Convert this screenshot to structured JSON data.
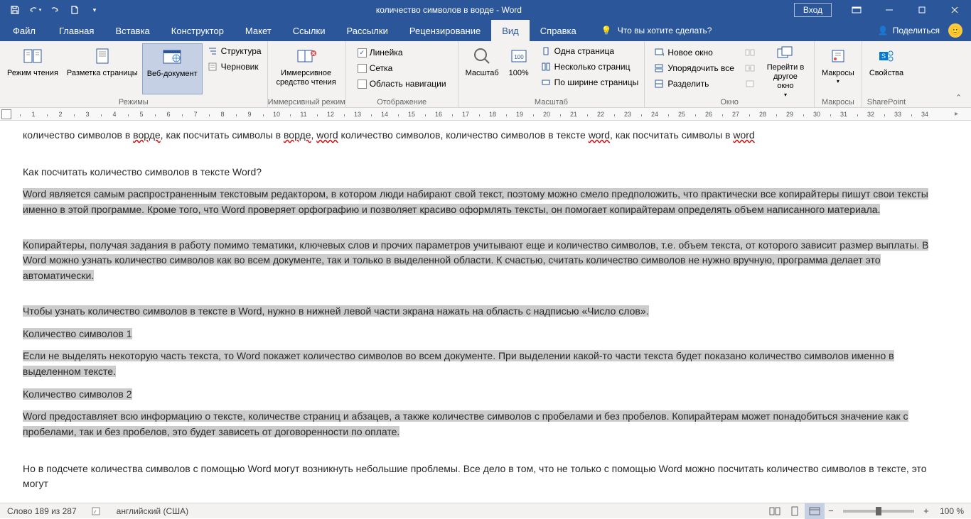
{
  "title": "количество символов в ворде  -  Word",
  "signin": "Вход",
  "tabs": {
    "file": "Файл",
    "items": [
      "Главная",
      "Вставка",
      "Конструктор",
      "Макет",
      "Ссылки",
      "Рассылки",
      "Рецензирование",
      "Вид",
      "Справка"
    ],
    "active": "Вид",
    "tellme_placeholder": "Что вы хотите сделать?",
    "share": "Поделиться"
  },
  "ribbon": {
    "modes": {
      "label": "Режимы",
      "read_mode": "Режим чтения",
      "print_layout": "Разметка страницы",
      "web_layout": "Веб-документ",
      "outline": "Структура",
      "draft": "Черновик"
    },
    "immersive": {
      "label": "Иммерсивный режим",
      "btn": "Иммерсивное средство чтения"
    },
    "show": {
      "label": "Отображение",
      "ruler": "Линейка",
      "grid": "Сетка",
      "nav": "Область навигации"
    },
    "zoom": {
      "label": "Масштаб",
      "zoom": "Масштаб",
      "hundred": "100%",
      "one": "Одна страница",
      "multi": "Несколько страниц",
      "width": "По ширине страницы"
    },
    "window": {
      "label": "Окно",
      "new": "Новое окно",
      "arrange": "Упорядочить все",
      "split": "Разделить",
      "switch": "Перейти в другое окно"
    },
    "macros": {
      "label": "Макросы",
      "btn": "Макросы"
    },
    "sharepoint": {
      "label": "SharePoint",
      "btn": "Свойства"
    }
  },
  "doc": {
    "p1_a": "количество символов в ",
    "p1_w1": "ворде",
    "p1_b": ", как посчитать символы в ",
    "p1_w2": "ворде",
    "p1_c": ", ",
    "p1_w3": "word",
    "p1_d": " количество символов, количество символов в тексте ",
    "p1_w4": "word",
    "p1_e": ", как посчитать символы в ",
    "p1_w5": "word",
    "p2": "Как посчитать количество символов в тексте Word?",
    "p3": "Word является самым распространенным текстовым редактором, в котором люди набирают свой текст, поэтому можно смело предположить, что практически все копирайтеры пишут свои тексты именно в этой программе. Кроме того, что Word проверяет орфографию и позволяет красиво оформлять тексты, он помогает копирайтерам определять объем написанного материала.",
    "p4": "Копирайтеры, получая задания в работу помимо тематики, ключевых слов и прочих параметров учитывают еще и количество символов, т.е. объем текста, от которого зависит размер выплаты. В Word можно узнать количество символов как во всем документе, так и только в выделенной области. К счастью, считать количество символов не нужно вручную, программа делает это автоматически.",
    "p5": "Чтобы узнать количество символов в тексте в Word, нужно в нижней левой части экрана нажать на область с надписью «Число слов».",
    "p6": "Количество символов 1",
    "p7": "Если не выделять некоторую часть текста, то Word покажет количество символов во всем документе. При выделении какой-то части текста будет показано количество символов именно в выделенном тексте.",
    "p8": "Количество символов 2",
    "p9": "Word предоставляет всю информацию о тексте, количестве страниц и абзацев, а также количестве символов с пробелами и без пробелов. Копирайтерам может понадобиться значение как с пробелами, так и без пробелов, это будет зависеть от договоренности по оплате.",
    "p10": "Но в подсчете количества символов с помощью Word могут возникнуть небольшие проблемы. Все дело в том, что не только с помощью Word можно посчитать количество символов в тексте, это могут"
  },
  "status": {
    "words": "Слово 189 из 287",
    "lang": "английский (США)",
    "zoom": "100 %"
  }
}
